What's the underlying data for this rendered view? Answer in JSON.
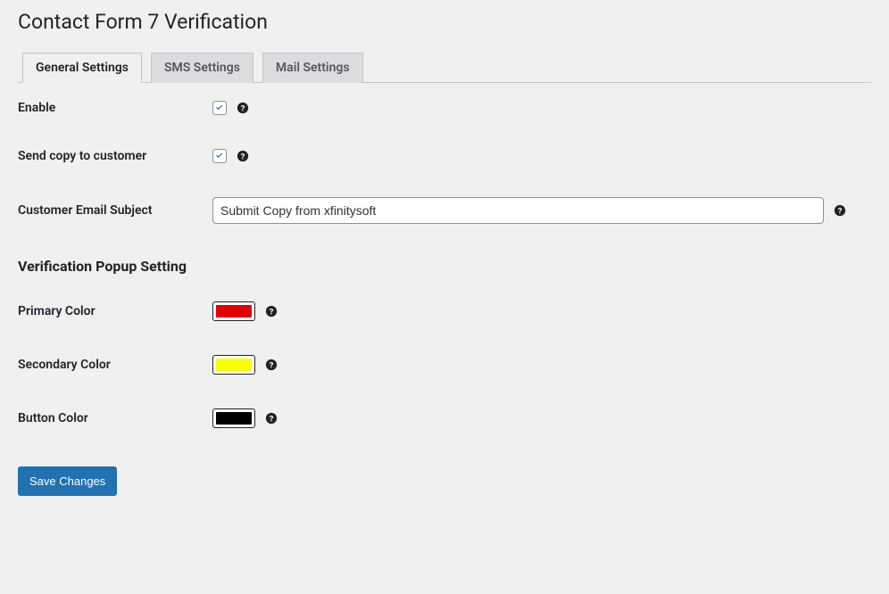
{
  "page": {
    "title": "Contact Form 7 Verification"
  },
  "tabs": [
    {
      "label": "General Settings",
      "active": true
    },
    {
      "label": "SMS Settings",
      "active": false
    },
    {
      "label": "Mail Settings",
      "active": false
    }
  ],
  "fields": {
    "enable": {
      "label": "Enable",
      "checked": true
    },
    "send_copy": {
      "label": "Send copy to customer",
      "checked": true
    },
    "email_subject": {
      "label": "Customer Email Subject",
      "value": "Submit Copy from xfinitysoft"
    }
  },
  "section": {
    "popup_heading": "Verification Popup Setting"
  },
  "colors": {
    "primary": {
      "label": "Primary Color",
      "value": "#e40000"
    },
    "secondary": {
      "label": "Secondary Color",
      "value": "#f7ff00"
    },
    "button": {
      "label": "Button Color",
      "value": "#000000"
    }
  },
  "buttons": {
    "save": "Save Changes"
  }
}
